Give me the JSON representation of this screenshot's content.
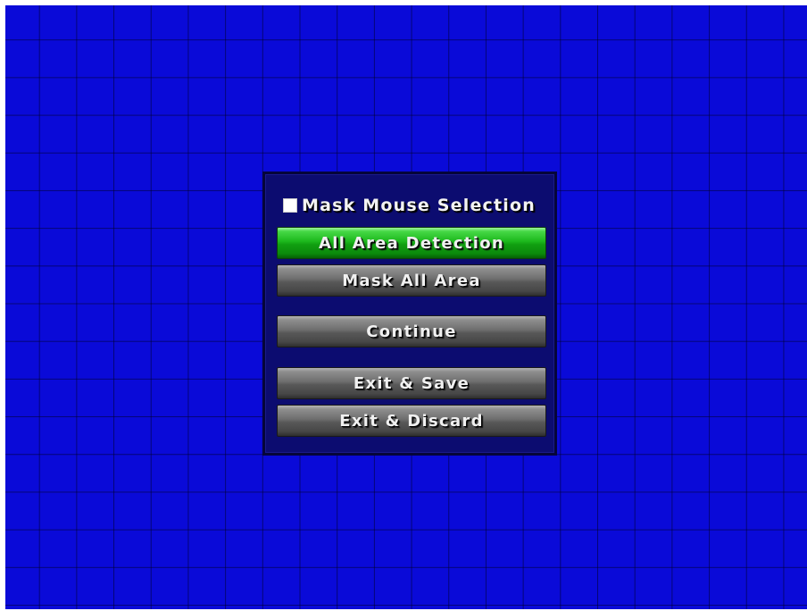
{
  "menu": {
    "checkbox": {
      "label": "Mask Mouse Selection",
      "checked": false
    },
    "buttons": [
      {
        "label": "All Area Detection",
        "selected": true
      },
      {
        "label": "Mask All Area",
        "selected": false
      },
      {
        "label": "Continue",
        "selected": false
      },
      {
        "label": "Exit & Save",
        "selected": false
      },
      {
        "label": "Exit & Discard",
        "selected": false
      }
    ]
  },
  "colors": {
    "background": "#0a0ad8",
    "panel": "#0c0c70",
    "selected_button": "#1cb81c",
    "button": "#6e6e6e"
  }
}
